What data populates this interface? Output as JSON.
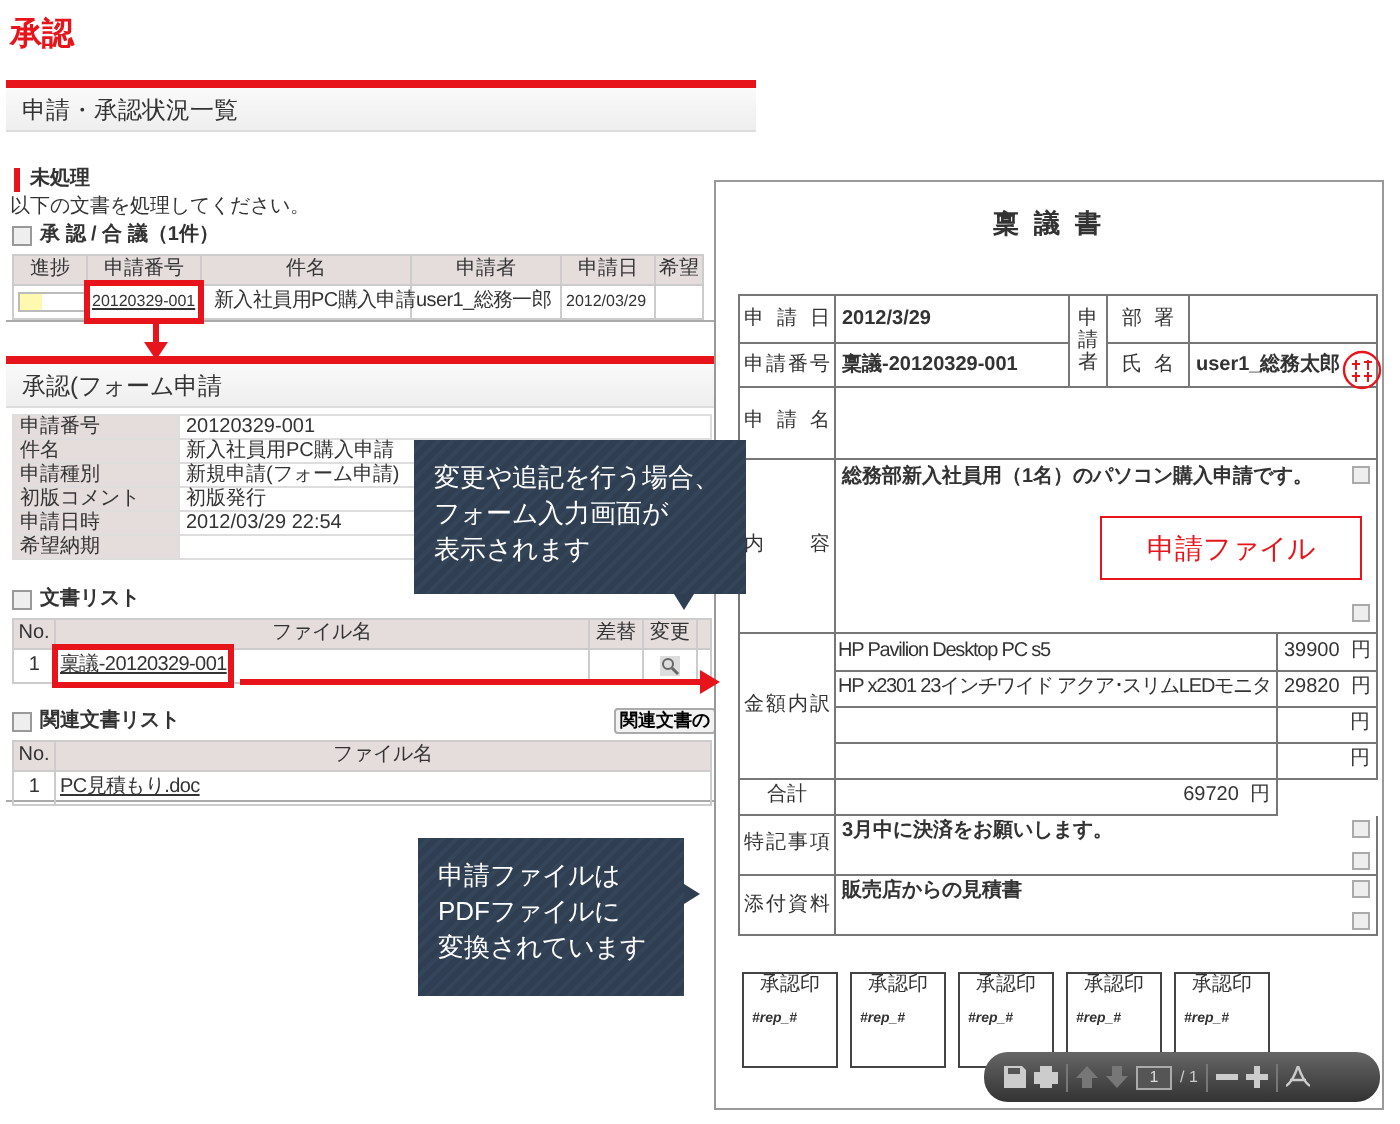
{
  "page_title": "承認",
  "list_screen": {
    "title": "申請・承認状況一覧",
    "section": "未処理",
    "instruction": "以下の文書を処理してください。",
    "subsection": "承 認 / 合 議（1件）",
    "columns": [
      "進捗",
      "申請番号",
      "件名",
      "申請者",
      "申請日",
      "希望"
    ],
    "rows": [
      {
        "level": 0.33,
        "number": "20120329-001",
        "subject": "新入社員用PC購入申請",
        "applicant": "user1_総務一郎",
        "date": "2012/03/29"
      }
    ]
  },
  "detail_screen": {
    "title": "承認(フォーム申請",
    "fields": [
      {
        "label": "申請番号",
        "value": "20120329-001"
      },
      {
        "label": "件名",
        "value": "新入社員用PC購入申請"
      },
      {
        "label": "申請種別",
        "value": "新規申請(フォーム申請)"
      },
      {
        "label": "初版コメント",
        "value": "初版発行"
      },
      {
        "label": "申請日時",
        "value": "2012/03/29 22:54"
      },
      {
        "label": "希望納期"
      }
    ],
    "documents": {
      "title": "文書リスト",
      "columns": [
        "No.",
        "ファイル名",
        "差替",
        "変更"
      ],
      "rows": [
        {
          "no": "1",
          "file": "稟議-20120329-001"
        }
      ]
    },
    "related": {
      "title": "関連文書リスト",
      "button": "関連文書の",
      "columns": [
        "No.",
        "ファイル名"
      ],
      "rows": [
        {
          "no": "1",
          "file": "PC見積もり.doc"
        }
      ]
    }
  },
  "callouts": [
    {
      "lines": [
        "変更や追記を行う場合、",
        "フォーム入力画面が",
        "表示されます"
      ]
    },
    {
      "lines": [
        "申請ファイルは",
        "PDFファイルに",
        "変換されています"
      ]
    }
  ],
  "document": {
    "title": "稟 議 書",
    "date_label": "申 請 日",
    "date": "2012/3/29",
    "applicant_label": "申請者",
    "dept_label": "部 署",
    "number_label": "申 請 番 号",
    "number": "稟議-20120329-001",
    "name_label": "氏 名",
    "name": "user1_総務太郎",
    "subject_label": "申請名",
    "content_label": "内 容",
    "content": "総務部新入社員用（1名）のパソコン購入申請です。",
    "file_label": "申請ファイル",
    "amount_label": "金 額 内 訳",
    "items": [
      {
        "name": "HP Pavilion Desktop PC s5",
        "amount": "39900",
        "unit": "円"
      },
      {
        "name": "HP x2301 23インチワイド アクア･スリムLEDモニタ",
        "amount": "29820",
        "unit": "円"
      },
      {
        "unit": "円"
      },
      {
        "unit": "円"
      }
    ],
    "total": {
      "label": "合計",
      "amount": "69720",
      "unit": "円"
    },
    "notes_label": "特 記 事 項",
    "notes": "3月中に決済をお願いします。",
    "attach_label": "添 付 資 料",
    "attachments": "販売店からの見積書",
    "stamps": [
      {
        "label": "承認印",
        "value": "#rep_#"
      },
      {
        "label": "承認印",
        "value": "#rep_#"
      },
      {
        "label": "承認印",
        "value": "#rep_#"
      },
      {
        "label": "承認印",
        "value": "#rep_#"
      },
      {
        "label": "承認印",
        "value": "#rep_#"
      }
    ],
    "pdf_toolbar": {
      "page": "1",
      "pages": "/ 1"
    }
  }
}
